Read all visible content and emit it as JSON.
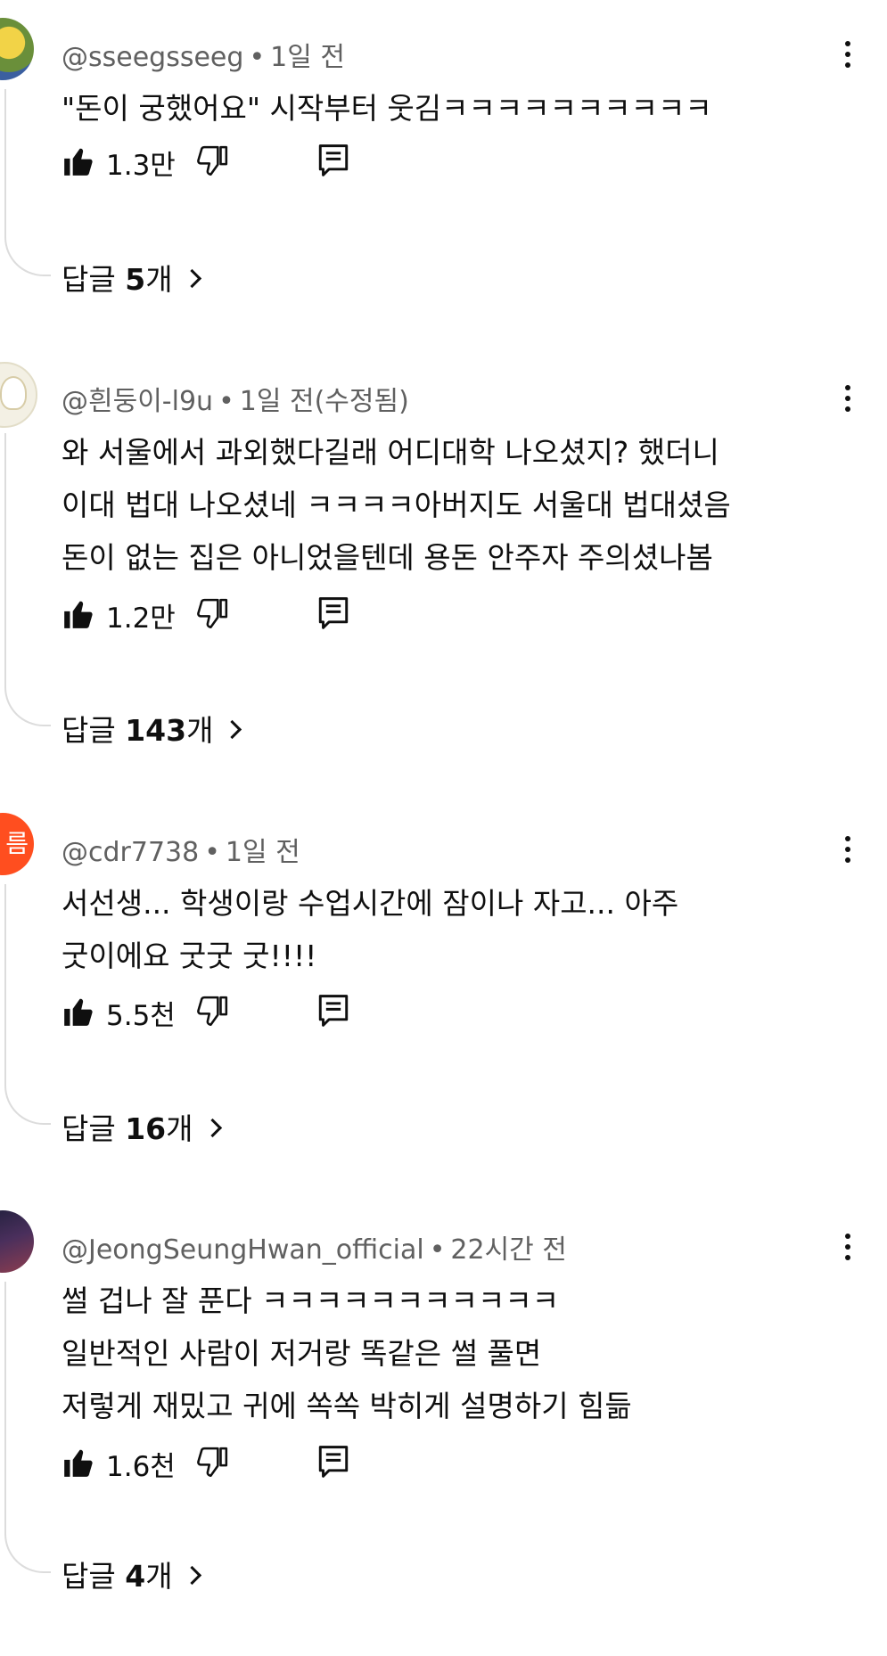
{
  "comments": [
    {
      "author": "@sseegsseeg",
      "time": "1일 전",
      "lines": [
        "\"돈이 궁했어요\" 시작부터 웃김ㅋㅋㅋㅋㅋㅋㅋㅋㅋㅋ"
      ],
      "likes": "1.3만",
      "replies_prefix": "답글 ",
      "replies_count": "5",
      "replies_suffix": "개"
    },
    {
      "author": "@흰둥이-l9u",
      "time": "1일 전(수정됨)",
      "lines": [
        "와 서울에서 과외했다길래 어디대학 나오셨지? 했더니",
        "이대 법대 나오셨네 ㅋㅋㅋㅋ아버지도 서울대 법대셨음",
        "돈이 없는 집은 아니었을텐데 용돈 안주자 주의셨나봄"
      ],
      "likes": "1.2만",
      "replies_prefix": "답글 ",
      "replies_count": "143",
      "replies_suffix": "개"
    },
    {
      "author": "@cdr7738",
      "time": "1일 전",
      "avatar_text": "름",
      "lines": [
        "서선생... 학생이랑 수업시간에 잠이나 자고... 아주",
        "굿이에요 굿굿 굿!!!!"
      ],
      "likes": "5.5천",
      "replies_prefix": "답글 ",
      "replies_count": "16",
      "replies_suffix": "개"
    },
    {
      "author": "@JeongSeungHwan_official",
      "time": "22시간 전",
      "lines": [
        "썰 겁나 잘 푼다 ㅋㅋㅋㅋㅋㅋㅋㅋㅋㅋㅋ",
        "일반적인 사람이 저거랑 똑같은 썰 풀면",
        "저렇게 재밌고 귀에 쏙쏙 박히게 설명하기 힘듦"
      ],
      "likes": "1.6천",
      "replies_prefix": "답글 ",
      "replies_count": "4",
      "replies_suffix": "개"
    }
  ],
  "separator": "•",
  "icons": {
    "like": "thumbs-up-icon-filled",
    "dislike": "thumbs-down-icon-outline",
    "reply": "reply-comment-icon",
    "more": "vertical-ellipsis-icon",
    "expand": "chevron-right-icon"
  }
}
